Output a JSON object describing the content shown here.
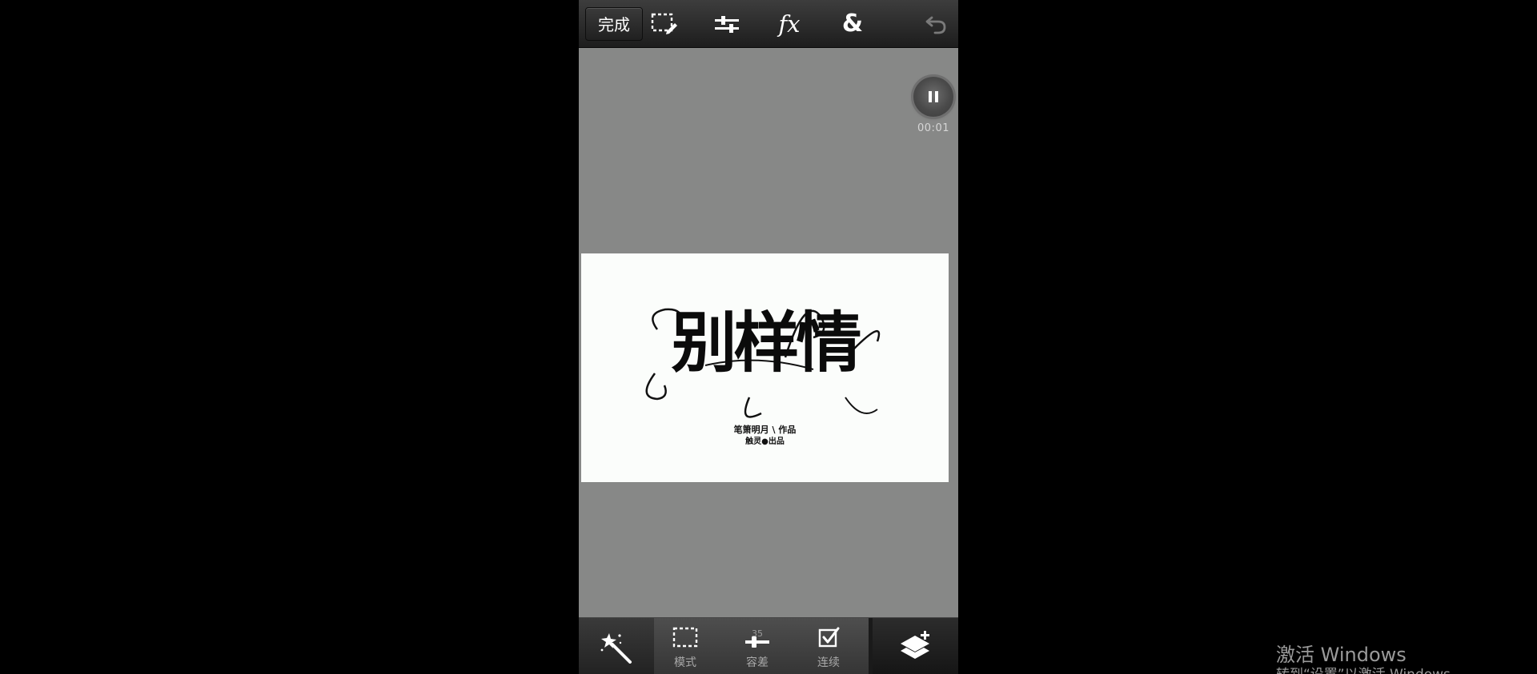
{
  "top_toolbar": {
    "done_label": "完成",
    "icons": [
      "selection-edit-icon",
      "adjustments-icon",
      "effects-icon",
      "text-icon",
      "undo-icon"
    ],
    "fx_label": "fx",
    "amp_label": "&"
  },
  "recording": {
    "timer": "00:01"
  },
  "canvas": {
    "title": "别样情",
    "credit_line_1": "笔箫明月 \\ 作品",
    "credit_line_2": "触灵●出品",
    "background": "#fbfdfb"
  },
  "bottom_toolbar": {
    "mode_label": "模式",
    "tolerance_label": "容差",
    "tolerance_value": "35",
    "contiguous_label": "连续"
  },
  "watermark": {
    "line_1": "激活 Windows",
    "line_2": "转到“设置”以激活 Windows。"
  },
  "colors": {
    "canvas_gray": "#878887",
    "toolbar": "#2a2a2a"
  }
}
